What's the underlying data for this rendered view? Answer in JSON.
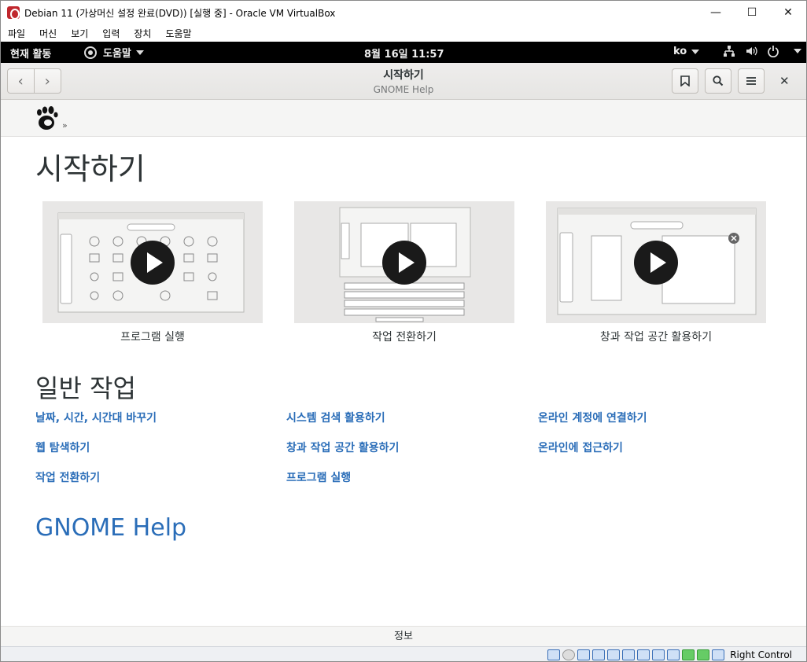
{
  "vbox": {
    "title": "Debian 11 (가상머신 설정 완료(DVD)) [실행 중] - Oracle VM VirtualBox",
    "menu": [
      "파일",
      "머신",
      "보기",
      "입력",
      "장치",
      "도움말"
    ],
    "status_host_key": "Right Control"
  },
  "topbar": {
    "activities": "현재 활동",
    "app_menu": "도움말",
    "clock": "8월 16일  11:57",
    "lang": "ko"
  },
  "header": {
    "title": "시작하기",
    "subtitle": "GNOME Help"
  },
  "page": {
    "breadcrumb_sep": "»",
    "heading": "시작하기",
    "videos": [
      {
        "caption": "프로그램 실행"
      },
      {
        "caption": "작업 전환하기"
      },
      {
        "caption": "창과 작업 공간 활용하기"
      }
    ],
    "section_heading": "일반 작업",
    "links": [
      "날짜, 시간, 시간대 바꾸기",
      "시스템 검색 활용하기",
      "온라인 계정에 연결하기",
      "웹 탐색하기",
      "창과 작업 공간 활용하기",
      "온라인에 접근하기",
      "작업 전환하기",
      "프로그램 실행"
    ],
    "gnome_help_link": "GNOME Help",
    "footer": "정보"
  }
}
